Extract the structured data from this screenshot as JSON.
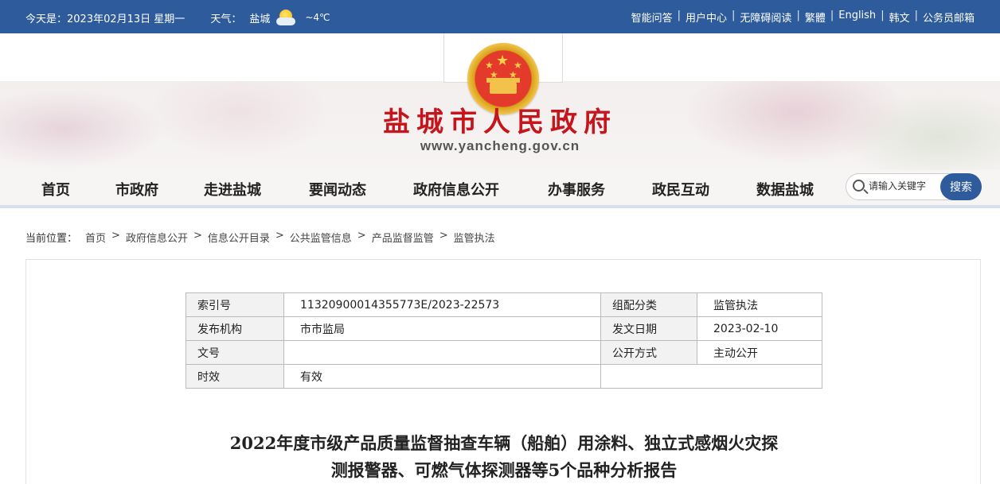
{
  "topbar": {
    "date_text": "今天是：2023年02月13日 星期一",
    "weather_label": "天气：",
    "city": "盐城",
    "weather_icon": "partly-cloudy-icon",
    "temperature": "~4℃",
    "links": [
      "智能问答",
      "用户中心",
      "无障碍阅读",
      "繁體",
      "English",
      "韩文",
      "公务员邮箱"
    ]
  },
  "banner": {
    "site_title": "盐城市人民政府",
    "site_url": "www.yancheng.gov.cn"
  },
  "nav": {
    "items": [
      "首页",
      "市政府",
      "走进盐城",
      "要闻动态",
      "政府信息公开",
      "办事服务",
      "政民互动",
      "数据盐城"
    ],
    "search_placeholder": "请输入关键字",
    "search_button": "搜索"
  },
  "breadcrumb": {
    "label": "当前位置：",
    "items": [
      "首页",
      "政府信息公开",
      "信息公开目录",
      "公共监管信息",
      "产品监督监管",
      "监管执法"
    ]
  },
  "meta": {
    "rows": [
      {
        "k1": "索引号",
        "v1": "11320900014355773E/2023-22573",
        "k2": "组配分类",
        "v2": "监管执法"
      },
      {
        "k1": "发布机构",
        "v1": "市市监局",
        "k2": "发文日期",
        "v2": "2023-02-10"
      },
      {
        "k1": "文号",
        "v1": "",
        "k2": "公开方式",
        "v2": "主动公开"
      },
      {
        "k1": "时效",
        "v1": "有效"
      }
    ]
  },
  "document": {
    "title_line1": "2022年度市级产品质量监督抽查车辆（船舶）用涂料、独立式感烟火灾探",
    "title_line2": "测报警器、可燃气体探测器等5个品种分析报告"
  }
}
